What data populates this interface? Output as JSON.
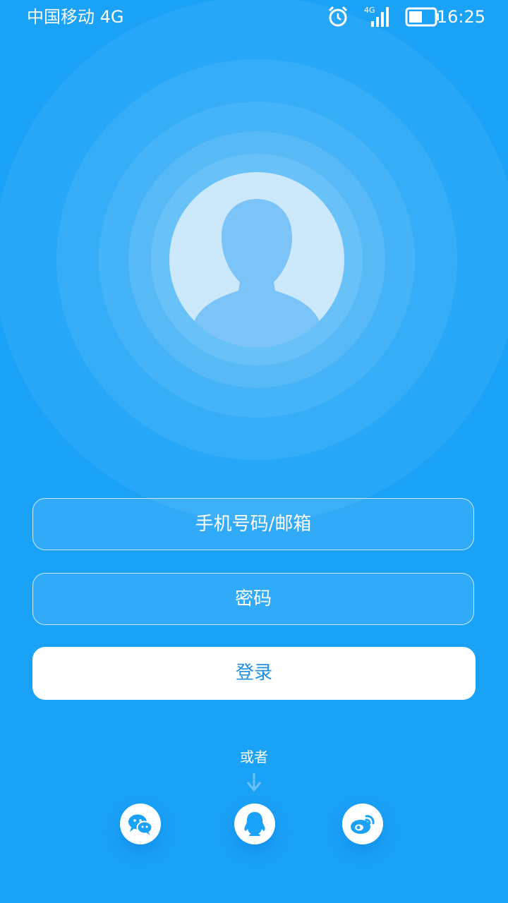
{
  "status_bar": {
    "carrier": "中国移动 4G",
    "time": "16:25",
    "network_label": "4G",
    "icons": [
      "alarm-icon",
      "signal-icon",
      "battery-icon"
    ]
  },
  "avatar": {
    "icon": "default-user-avatar-icon"
  },
  "form": {
    "phone_placeholder": "手机号码/邮箱",
    "password_placeholder": "密码",
    "login_label": "登录"
  },
  "alt_login": {
    "or_label": "或者",
    "providers": [
      "wechat-icon",
      "qq-icon",
      "weibo-icon"
    ]
  },
  "colors": {
    "background": "#1aa2f7",
    "accent": "#1f8fe6",
    "button_bg": "#ffffff"
  }
}
